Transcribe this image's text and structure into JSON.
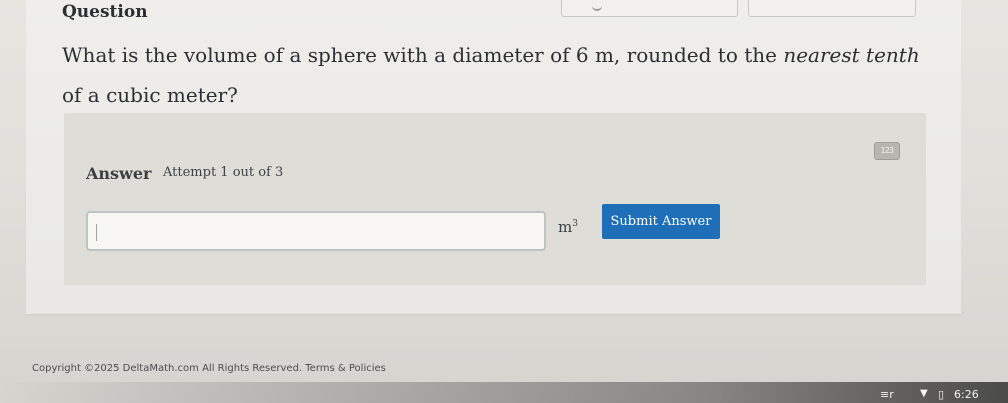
{
  "question": {
    "heading": "Question",
    "text_before": "What is the volume of a sphere with a diameter of 6 m, rounded to the ",
    "text_emphasis": "nearest tenth",
    "text_after": " of a cubic meter?"
  },
  "answer": {
    "label": "Answer",
    "attempt_text": "Attempt 1 out of 3",
    "input_value": "",
    "unit_base": "m",
    "unit_exponent": "3",
    "submit_label": "Submit Answer",
    "keypad_icon": "keyboard-icon",
    "keypad_glyph": "123"
  },
  "footer": {
    "copyright": "Copyright ©2025 DeltaMath.com All Rights Reserved. Terms & Policies"
  },
  "taskbar": {
    "ime_icon": "≡r",
    "wifi_icon": "▼",
    "battery_icon": "▯",
    "time": "6:26"
  },
  "colors": {
    "submit_bg": "#1f6fb8",
    "page_bg": "#e1dfda",
    "panel_bg": "#dfddd8"
  }
}
